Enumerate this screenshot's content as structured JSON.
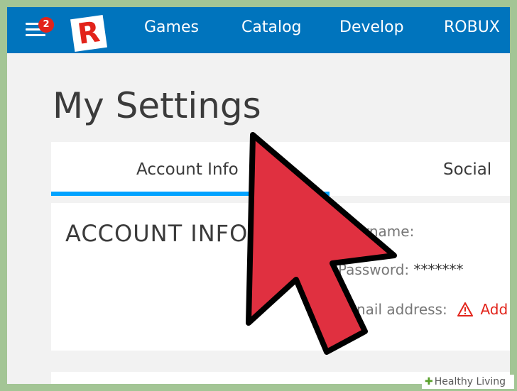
{
  "header": {
    "notification_count": "2",
    "logo_letter": "R",
    "nav": [
      "Games",
      "Catalog",
      "Develop",
      "ROBUX"
    ]
  },
  "page": {
    "title": "My Settings"
  },
  "tabs": [
    {
      "label": "Account Info",
      "active": true
    },
    {
      "label": "Social",
      "active": false
    }
  ],
  "account_info": {
    "heading": "ACCOUNT INFO",
    "username_label": "rname:",
    "password_label": "Password:",
    "password_value": "*******",
    "email_label": "nail address:",
    "email_action": "Add"
  },
  "watermark": {
    "text": "Healthy Living"
  },
  "colors": {
    "header_blue": "#0074bd",
    "tab_accent": "#00a2ff",
    "cursor_red": "#e03040",
    "warning_red": "#e2231a",
    "frame_green": "#a3c595"
  },
  "icons": {
    "menu": "hamburger-menu-icon",
    "logo": "roblox-logo",
    "warning": "warning-triangle-icon",
    "cursor": "mouse-pointer-arrow"
  }
}
